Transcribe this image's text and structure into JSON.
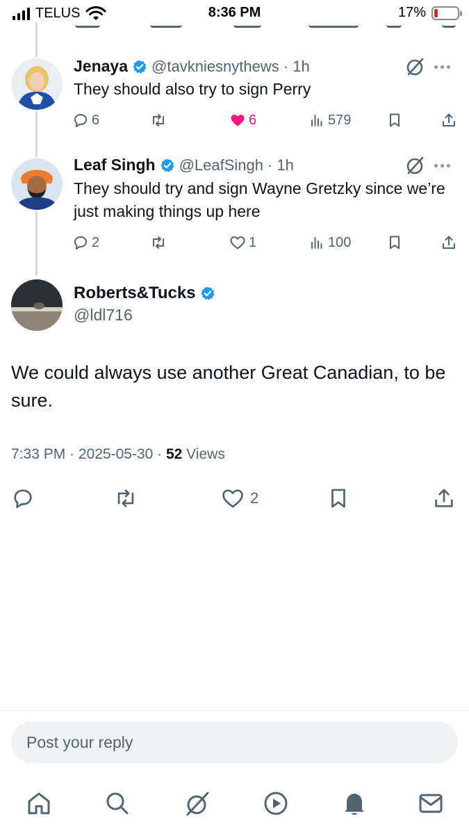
{
  "status_bar": {
    "carrier": "TELUS",
    "time": "8:36 PM",
    "battery_percent": "17%",
    "battery_level": 0.17,
    "battery_color": "#e0241e"
  },
  "replies": [
    {
      "name": "Jenaya",
      "handle": "@tavkniesnythews",
      "time": "· 1h",
      "text": "They should also try to sign Perry",
      "replies": "6",
      "reposts": "",
      "likes": "6",
      "liked": true,
      "views": "579"
    },
    {
      "name": "Leaf Singh",
      "handle": "@LeafSingh",
      "time": "· 1h",
      "text": "They should try and sign Wayne Gretzky since we’re just making things up here",
      "replies": "2",
      "reposts": "",
      "likes": "1",
      "liked": false,
      "views": "100"
    }
  ],
  "main_tweet": {
    "name": "Roberts&Tucks",
    "handle": "@ldl716",
    "text": "We could always use another Great Canadian, to be sure.",
    "time": "7:33 PM",
    "separator": " · ",
    "date": "2025-05-30",
    "views_count": "52",
    "views_label": " Views",
    "likes": "2"
  },
  "composer": {
    "placeholder": "Post your reply"
  },
  "tabbar": {
    "items": [
      "home-icon",
      "search-icon",
      "grok-icon",
      "video-icon",
      "notifications-icon",
      "messages-icon"
    ]
  },
  "colors": {
    "verified": "#1d9bf0",
    "like_active": "#f91880",
    "text_secondary": "#536471"
  }
}
